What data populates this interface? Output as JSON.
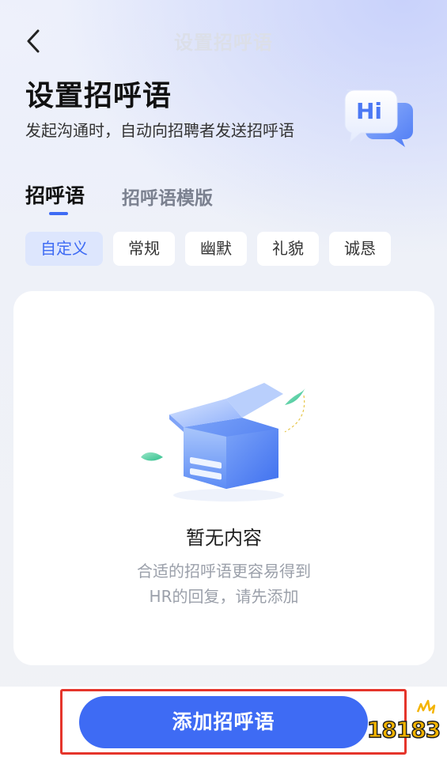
{
  "nav": {
    "title": "设置招呼语",
    "back_icon": "chevron-left-icon"
  },
  "header": {
    "title": "设置招呼语",
    "subtitle": "发起沟通时，自动向招聘者发送招呼语",
    "badge_text": "Hi",
    "badge_icon": "hi-chat-bubble-icon"
  },
  "tabs": [
    {
      "label": "招呼语",
      "active": true
    },
    {
      "label": "招呼语模版",
      "active": false
    }
  ],
  "chips": [
    {
      "label": "自定义",
      "active": true
    },
    {
      "label": "常规",
      "active": false
    },
    {
      "label": "幽默",
      "active": false
    },
    {
      "label": "礼貌",
      "active": false
    },
    {
      "label": "诚恳",
      "active": false
    }
  ],
  "empty_state": {
    "illustration": "empty-box-icon",
    "title": "暂无内容",
    "desc_line1": "合适的招呼语更容易得到",
    "desc_line2": "HR的回复，请先添加"
  },
  "footer": {
    "add_button_label": "添加招呼语"
  },
  "watermark": {
    "text": "18183"
  },
  "colors": {
    "accent": "#3e6bf4",
    "highlight": "#e5352b",
    "chip_active_bg": "#dde6fd"
  }
}
